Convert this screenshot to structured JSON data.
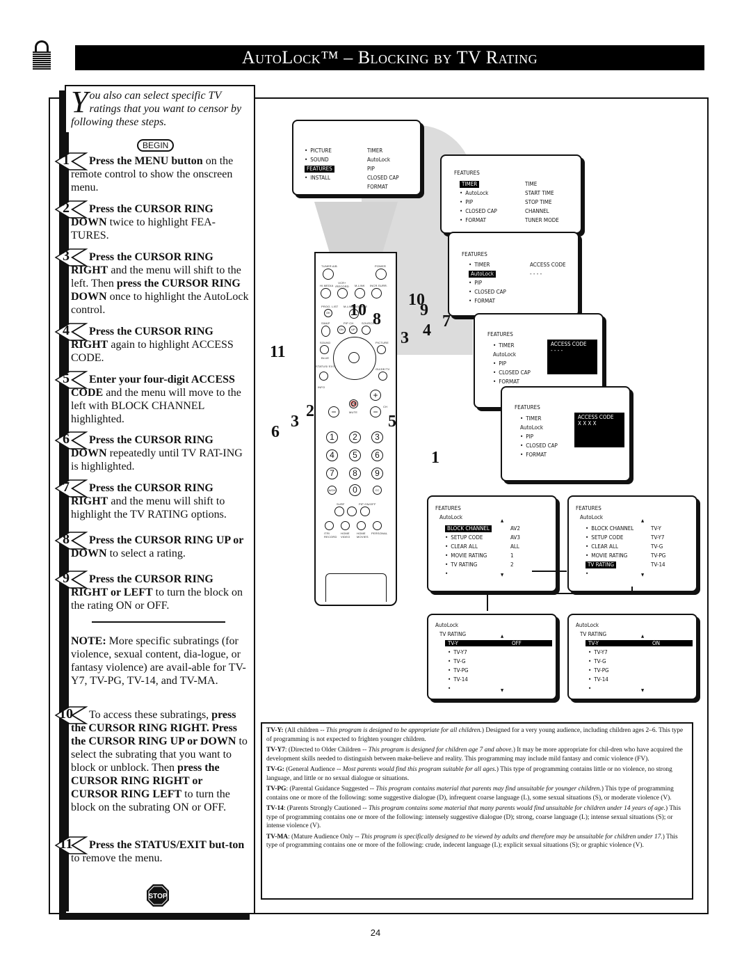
{
  "header": {
    "title": "AutoLock™ – Blocking by TV Rating",
    "icon": "padlock-icon"
  },
  "intro": {
    "dropcap": "Y",
    "text": "ou also can select specific TV ratings that you want to censor by following these steps.",
    "begin_label": "BEGIN"
  },
  "steps": [
    {
      "num": "1",
      "bold": "Press the MENU button",
      "rest": " on the remote control to show the onscreen menu."
    },
    {
      "num": "2",
      "bold": "Press the CURSOR RING DOWN",
      "rest": " twice to highlight FEA-TURES."
    },
    {
      "num": "3",
      "bold": "Press the CURSOR RING RIGHT",
      "rest": " and the menu will shift to the left. Then ",
      "bold2": "press the CURSOR RING DOWN",
      "rest2": " once to highlight the AutoLock control."
    },
    {
      "num": "4",
      "bold": "Press the CURSOR RING RIGHT",
      "rest": " again to highlight ACCESS CODE."
    },
    {
      "num": "5",
      "bold": "Enter your four-digit ACCESS CODE",
      "rest": " and the menu will move to the left with BLOCK CHANNEL highlighted."
    },
    {
      "num": "6",
      "bold": "Press the CURSOR RING DOWN",
      "rest": " repeatedly until TV RAT-ING is highlighted."
    },
    {
      "num": "7",
      "bold": "Press the CURSOR RING RIGHT",
      "rest": " and the menu will shift to highlight the TV RATING options."
    },
    {
      "num": "8",
      "bold": "Press the CURSOR RING UP or DOWN",
      "rest": " to select a rating."
    },
    {
      "num": "9",
      "bold": "Press the CURSOR RING RIGHT or LEFT",
      "rest": " to turn the block on the rating ON or OFF."
    },
    {
      "num": "10",
      "pre": "To access these subratings, ",
      "bold": "press the CURSOR RING RIGHT. Press the CURSOR RING UP or DOWN",
      "rest": " to select the subrating that you want to block or unblock. Then ",
      "bold2": "press the CURSOR RING RIGHT or CURSOR RING LEFT",
      "rest2": " to turn the block on the subrating ON or OFF."
    },
    {
      "num": "11",
      "bold": "Press the STATUS/EXIT but-ton",
      "rest": " to remove the menu."
    }
  ],
  "note": {
    "label": "NOTE:",
    "text": " More specific subratings (for violence, sexual content, dia-logue, or fantasy violence) are avail-able for TV-Y7, TV-PG, TV-14, and TV-MA."
  },
  "stop_label": "STOP",
  "remote": {
    "labels": [
      "TUNER A/B",
      "POWER",
      "HI.MEDIA",
      "VCR+ /RECORD",
      "M-LINK",
      "INCR.SURR.",
      "PROG. LIST",
      "M-LINK SOURCE",
      "SWAP",
      "PIP CH",
      "SOURCE",
      "SOUND",
      "PICTURE",
      "BLUE",
      "STATUS/ EXIT",
      "GUIDE/TV",
      "INFO",
      "MUTE",
      "CH",
      "SURF",
      "PIP ON/OFF",
      "ITR/ RECORD",
      "HOME VIDEO",
      "HOME MOVIES",
      "PERSONAL"
    ],
    "pip_dn": "DN",
    "pip_up": "UP",
    "ok": "OK",
    "digits": [
      "1",
      "2",
      "3",
      "4",
      "5",
      "6",
      "7",
      "8",
      "9",
      "0"
    ],
    "ach": "A/CH",
    "cc": "CC"
  },
  "callouts": [
    "10",
    "10",
    "8",
    "9",
    "7",
    "4",
    "3",
    "11",
    "2",
    "3",
    "6",
    "5",
    "1"
  ],
  "screens": {
    "main_menu": {
      "left": [
        "PICTURE",
        "SOUND",
        "FEATURES",
        "INSTALL"
      ],
      "highlighted": "FEATURES",
      "right": [
        "TIMER",
        "AutoLock",
        "PIP",
        "CLOSED CAP",
        "FORMAT"
      ]
    },
    "features_timer": {
      "title": "FEATURES",
      "left": [
        "TIMER",
        "AutoLock",
        "PIP",
        "CLOSED CAP",
        "FORMAT"
      ],
      "highlighted": "TIMER",
      "right": [
        "TIME",
        "START TIME",
        "STOP TIME",
        "CHANNEL",
        "TUNER MODE"
      ]
    },
    "features_autolock": {
      "title": "FEATURES",
      "left": [
        "TIMER",
        "AutoLock",
        "PIP",
        "CLOSED CAP",
        "FORMAT"
      ],
      "highlighted": "AutoLock",
      "right_title": "ACCESS CODE",
      "right_value": "- - - -"
    },
    "access_code_blank": {
      "title": "FEATURES",
      "left": [
        "TIMER",
        "AutoLock",
        "PIP",
        "CLOSED CAP",
        "FORMAT"
      ],
      "right_title": "ACCESS CODE",
      "right_value": "- - - -"
    },
    "access_code_entered": {
      "title": "FEATURES",
      "left": [
        "TIMER",
        "AutoLock",
        "PIP",
        "CLOSED CAP",
        "FORMAT"
      ],
      "right_title": "ACCESS CODE",
      "right_value": "X X X X"
    },
    "autolock_block": {
      "title": "FEATURES",
      "subtitle": "AutoLock",
      "left": [
        "BLOCK CHANNEL",
        "SETUP CODE",
        "CLEAR ALL",
        "MOVIE RATING",
        "TV RATING"
      ],
      "highlighted": "BLOCK CHANNEL",
      "right": [
        "AV2",
        "AV3",
        "ALL",
        "1",
        "2"
      ]
    },
    "autolock_tvrating": {
      "title": "FEATURES",
      "subtitle": "AutoLock",
      "left": [
        "BLOCK CHANNEL",
        "SETUP CODE",
        "CLEAR ALL",
        "MOVIE RATING",
        "TV RATING"
      ],
      "highlighted": "TV RATING",
      "right": [
        "TV-Y",
        "TV-Y7",
        "TV-G",
        "TV-PG",
        "TV-14"
      ]
    },
    "tvrating_off": {
      "title": "AutoLock",
      "subtitle": "TV RATING",
      "items": [
        "TV-Y",
        "TV-Y7",
        "TV-G",
        "TV-PG",
        "TV-14"
      ],
      "highlighted": "TV-Y",
      "value": "OFF"
    },
    "tvrating_on": {
      "title": "AutoLock",
      "subtitle": "TV RATING",
      "items": [
        "TV-Y",
        "TV-Y7",
        "TV-G",
        "TV-PG",
        "TV-14"
      ],
      "highlighted": "TV-Y",
      "value": "ON"
    }
  },
  "definitions": [
    {
      "code": "TV-Y:",
      "paren_open": " (All children -- ",
      "italic": "This program is designed to be appropriate for all children.",
      "rest": ")  Designed for a very young audience, including children ages 2–6.  This type of programming is not expected to frighten younger children."
    },
    {
      "code": "TV-Y7",
      "paren_open": ":  (Directed to Older Children -- ",
      "italic": "This program is designed for children age 7 and above.",
      "rest": ")  It may be more appropriate for chil-dren who have acquired the development skills needed to distinguish between make-believe and reality.  This programming may include mild fantasy and comic violence (FV)."
    },
    {
      "code": "TV-G:",
      "paren_open": "  (General Audience -- ",
      "italic": "Most parents would find this program suitable for all ages.",
      "rest": ")  This type of programming contains little or no violence, no strong language, and little or no sexual dialogue or situations."
    },
    {
      "code": "TV-PG",
      "paren_open": ":  (Parental Guidance Suggested -- ",
      "italic": "This program contains material that parents may find unsuitable for younger children.",
      "rest": ")  This type of programming contains one or more of the following:  some suggestive dialogue (D), infrequent coarse language (L), some sexual situations (S), or moderate violence (V)."
    },
    {
      "code": "TV-14",
      "paren_open": ":  (Parents Strongly Cautioned -- ",
      "italic": "This program contains some material that many parents would find unsuitable for children under 14 years of age.",
      "rest": ")  This type of programming contains one or more of the following:  intensely suggestive dialogue (D); strong, coarse language (L); intense sexual situations (S); or intense violence (V)."
    },
    {
      "code": "TV-MA",
      "paren_open": ":  (Mature Audience Only -- ",
      "italic": "This program is specifically designed to be viewed by adults and therefore may be unsuitable for children under 17.",
      "rest": ")  This type of programming contains one or more of the following:  crude, indecent language (L); explicit sexual situations (S); or graphic violence (V)."
    }
  ],
  "page_number": "24"
}
